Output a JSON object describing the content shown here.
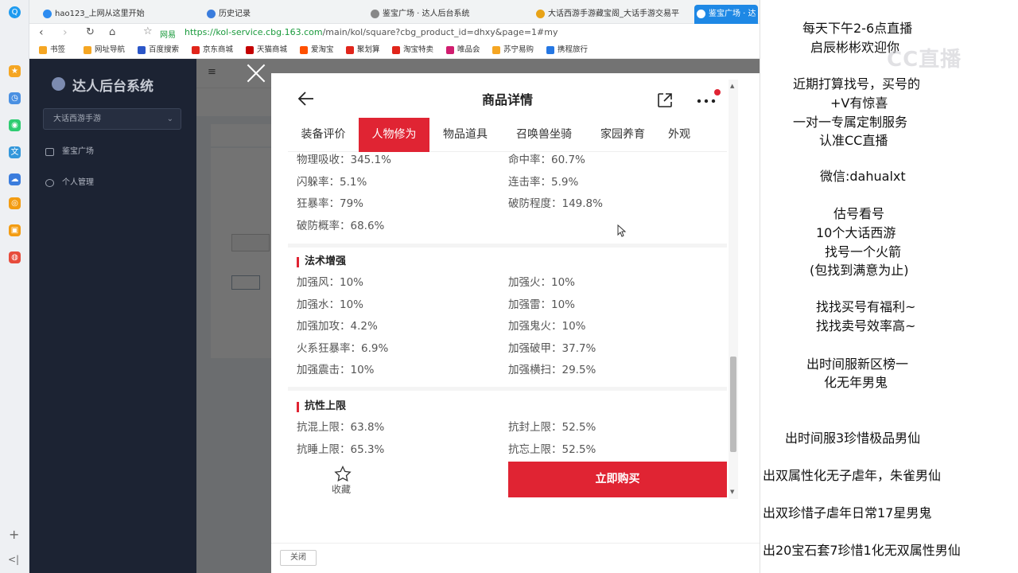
{
  "browser": {
    "tabs": [
      {
        "label": "hao123_上网从这里开始",
        "color": "#2d8cf0"
      },
      {
        "label": "历史记录",
        "color": "#3b7ddd"
      },
      {
        "label": "鉴宝广场 · 达人后台系统",
        "color": "#888888"
      },
      {
        "label": "大话西游手游藏宝阁_大话手游交易平",
        "color": "#e8a317"
      },
      {
        "label": "鉴宝广场 · 达",
        "color": "#ffffff"
      }
    ],
    "address_host_label": "网易",
    "url_scheme_host": "https://kol-service.cbg.163.com",
    "url_rest": "/main/kol/square?cbg_product_id=dhxy&page=1#my",
    "bookmarks": [
      {
        "label": "书签",
        "color": "#f5a623"
      },
      {
        "label": "网址导航",
        "color": "#f5a623"
      },
      {
        "label": "百度搜索",
        "color": "#2b56c8"
      },
      {
        "label": "京东商城",
        "color": "#e1251b"
      },
      {
        "label": "天猫商城",
        "color": "#c40000"
      },
      {
        "label": "爱淘宝",
        "color": "#ff5000"
      },
      {
        "label": "聚划算",
        "color": "#e1251b"
      },
      {
        "label": "淘宝特卖",
        "color": "#e1251b"
      },
      {
        "label": "唯品会",
        "color": "#d11d6f"
      },
      {
        "label": "苏宁易购",
        "color": "#f5a623"
      },
      {
        "label": "携程旅行",
        "color": "#2577e3"
      }
    ]
  },
  "admin": {
    "brand": "达人后台系统",
    "game_select": "大话西游手游",
    "sidebar": [
      "鉴宝广场",
      "个人管理"
    ]
  },
  "modal": {
    "close_button": "关闭"
  },
  "phone": {
    "title": "商品详情",
    "tabs": [
      "装备评价",
      "人物修为",
      "物品道具",
      "召唤兽坐骑",
      "家园养育",
      "外观"
    ],
    "active_tab": "人物修为",
    "top_stats": [
      [
        "物理吸收：",
        "345.1%",
        "命中率：",
        "60.7%"
      ],
      [
        "闪躲率：",
        "5.1%",
        "连击率：",
        "5.9%"
      ],
      [
        "狂暴率：",
        "79%",
        "破防程度：",
        "149.8%"
      ],
      [
        "破防概率：",
        "68.6%",
        "",
        ""
      ]
    ],
    "magic_title": "法术增强",
    "magic_stats": [
      [
        "加强风：",
        "10%",
        "加强火：",
        "10%"
      ],
      [
        "加强水：",
        "10%",
        "加强雷：",
        "10%"
      ],
      [
        "加强加攻：",
        "4.2%",
        "加强鬼火：",
        "10%"
      ],
      [
        "火系狂暴率：",
        "6.9%",
        "加强破甲：",
        "37.7%"
      ],
      [
        "加强震击：",
        "10%",
        "加强横扫：",
        "29.5%"
      ]
    ],
    "resist_title": "抗性上限",
    "resist_stats": [
      [
        "抗混上限：",
        "63.8%",
        "抗封上限：",
        "52.5%"
      ],
      [
        "抗睡上限：",
        "65.3%",
        "抗忘上限：",
        "52.5%"
      ]
    ],
    "fav_label": "收藏",
    "buy_label": "立即购买"
  },
  "stream": {
    "watermark": "CC直播",
    "lines": [
      "每天下午2-6点直播",
      "启辰彬彬欢迎你",
      "近期打算找号，买号的",
      "+V有惊喜",
      "一对一专属定制服务",
      "认准CC直播",
      "微信:dahualxt",
      "估号看号",
      "10个大话西游",
      "找号一个火箭",
      "(包找到满意为止)",
      "找找买号有福利~",
      "找找卖号效率高~",
      "出时间服新区榜一",
      "化无年男鬼",
      "出时间服3珍惜极品男仙",
      "出双属性化无子虐年，朱雀男仙",
      "出双珍惜子虐年日常17星男鬼",
      "出20宝石套7珍惜1化无双属性男仙"
    ]
  }
}
